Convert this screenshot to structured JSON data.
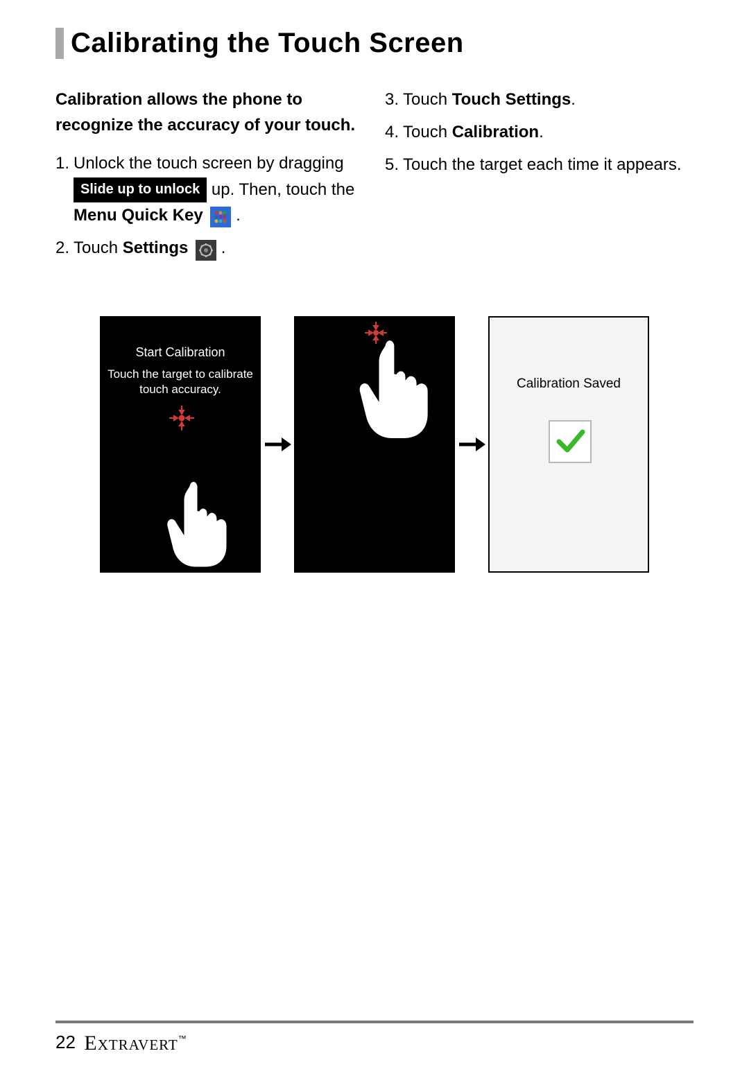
{
  "title": "Calibrating the Touch Screen",
  "intro": "Calibration allows the phone to recognize the accuracy of your touch.",
  "steps": {
    "left": [
      {
        "num": "1.",
        "parts": {
          "a": "Unlock the touch screen by dragging ",
          "unlock_label": "Slide up to unlock",
          "b": " up. Then, touch the ",
          "menu": "Menu Quick Key",
          "period": " ."
        }
      },
      {
        "num": "2.",
        "parts": {
          "a": "Touch ",
          "bold": "Settings",
          "period": " ."
        }
      }
    ],
    "right": [
      {
        "num": "3.",
        "a": "Touch ",
        "bold": "Touch Settings",
        "period": "."
      },
      {
        "num": "4.",
        "a": "Touch ",
        "bold": "Calibration",
        "period": "."
      },
      {
        "num": "5.",
        "a": "Touch the target each time it appears."
      }
    ]
  },
  "figure": {
    "screen1": {
      "title": "Start Calibration",
      "sub": "Touch the target to calibrate touch accuracy."
    },
    "screen3": {
      "saved": "Calibration Saved"
    }
  },
  "footer": {
    "page": "22",
    "brand": "Extravert",
    "tm": "™"
  }
}
